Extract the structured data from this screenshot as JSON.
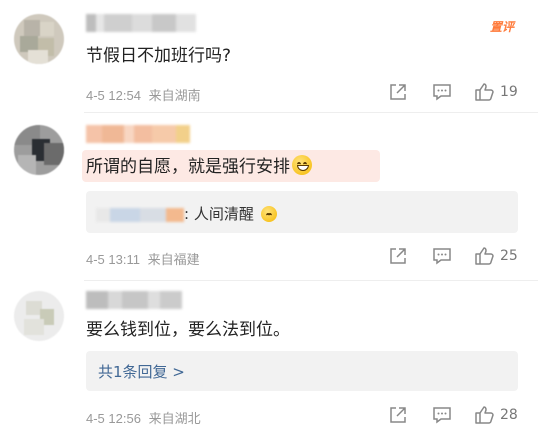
{
  "comments": [
    {
      "text": "节假日不加班行吗?",
      "time": "4-5 12:54",
      "location": "来自湖南",
      "likes": "19",
      "badge": "置评"
    },
    {
      "text": "所谓的自愿，就是强行安排",
      "reply_text": ": 人间清醒",
      "time": "4-5 13:11",
      "location": "来自福建",
      "likes": "25"
    },
    {
      "text": "要么钱到位，要么法到位。",
      "replies_link": "共1条回复 >",
      "time": "4-5 12:56",
      "location": "来自湖北",
      "likes": "28"
    }
  ],
  "icons": {
    "share": "share-icon",
    "comment": "comment-icon",
    "like": "thumbs-up-icon",
    "emoji": "grin-emoji-icon",
    "laugh": "laugh-emoji-icon"
  },
  "colors": {
    "meta": "#999999",
    "link": "#416895",
    "badge": "#ff7a3a",
    "reply_bg": "#f2f2f2"
  }
}
